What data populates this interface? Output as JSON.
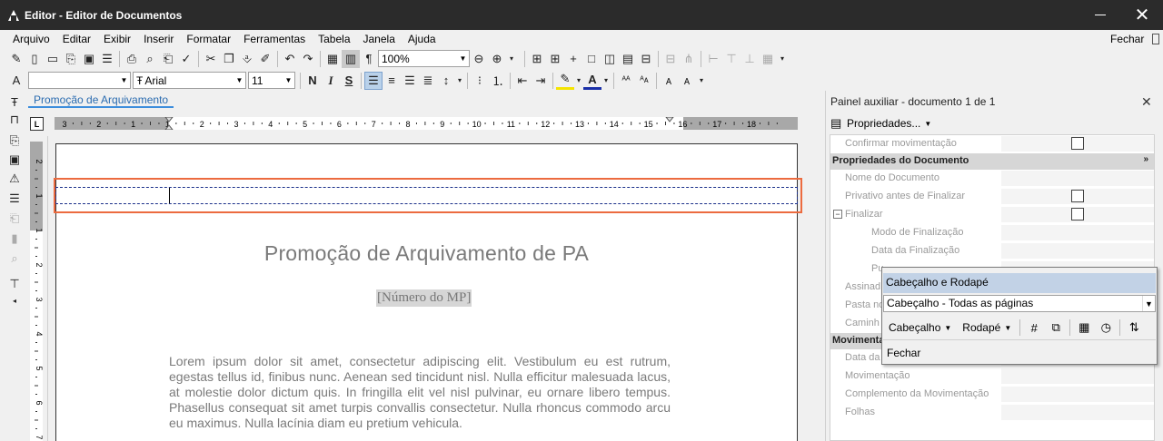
{
  "window": {
    "title": "Editor - Editor de Documentos",
    "close_glyph": "✕"
  },
  "menu": {
    "items": [
      "Arquivo",
      "Editar",
      "Exibir",
      "Inserir",
      "Formatar",
      "Ferramentas",
      "Tabela",
      "Janela",
      "Ajuda"
    ],
    "close_label": "Fechar"
  },
  "toolbar": {
    "zoom_value": "100%",
    "style_value": "",
    "font_value": "Arial",
    "font_prefix": "Ŧ",
    "size_value": "11",
    "bold_label": "N",
    "italic_label": "I",
    "strike_label": "S",
    "pilcrow": "¶"
  },
  "tab": {
    "label": "Promoção de Arquivamento"
  },
  "ruler": {
    "corner_label": "L",
    "top_numbers": [
      "3",
      "2",
      "1",
      "1",
      "2",
      "3",
      "4",
      "5",
      "6",
      "7",
      "8",
      "9",
      "10",
      "11",
      "12",
      "13",
      "14",
      "15",
      "16",
      "17",
      "18"
    ],
    "side_numbers": [
      "2",
      "1",
      "1",
      "2",
      "3",
      "4",
      "5",
      "6",
      "7"
    ]
  },
  "document": {
    "title": "Promoção de Arquivamento de PA",
    "subtitle": "[Número do MP]",
    "body": "Lorem ipsum dolor sit amet, consectetur adipiscing elit. Vestibulum eu est rutrum, egestas tellus id, finibus nunc. Aenean sed tincidunt nisl. Nulla efficitur malesuada lacus, at molestie dolor dictum quis. In fringilla elit vel nisl pulvinar, eu ornare libero tempus. Phasellus consequat sit amet turpis convallis consectetur. Nulla rhoncus commodo arcu eu maximus. Nulla lacínia diam eu pretium vehicula."
  },
  "panel": {
    "title": "Painel auxiliar - documento 1 de 1",
    "close_glyph": "✕",
    "combo_label": "Propriedades...",
    "rows_top": [
      {
        "label": "Confirmar movimentação",
        "checkbox": true
      }
    ],
    "section1": "Propriedades do Documento",
    "section1_toggle": "»",
    "rows_doc": [
      {
        "label": "Nome do Documento",
        "checkbox": false
      },
      {
        "label": "Privativo antes de Finalizar",
        "checkbox": true
      },
      {
        "label": "Finalizar",
        "checkbox": true,
        "expander": "−"
      },
      {
        "label": "Modo de Finalização",
        "checkbox": false
      },
      {
        "label": "Data da Finalização",
        "checkbox": false
      },
      {
        "label": "Pu",
        "checkbox": false
      },
      {
        "label": "Assinad",
        "checkbox": false
      },
      {
        "label": "Pasta no",
        "checkbox": false
      },
      {
        "label": "Caminh",
        "checkbox": false
      }
    ],
    "section2": "Movimenta",
    "rows_mov": [
      {
        "label": "Data da",
        "checkbox": false
      },
      {
        "label": "Movimentação",
        "checkbox": false
      },
      {
        "label": "Complemento da Movimentação",
        "checkbox": false
      },
      {
        "label": "Folhas",
        "checkbox": false
      }
    ]
  },
  "float_toolbar": {
    "title": "Cabeçalho e Rodapé",
    "combo_value": "Cabeçalho -  Todas as páginas",
    "header_button": "Cabeçalho",
    "footer_button": "Rodapé",
    "close_label": "Fechar"
  },
  "colors": {
    "header_highlight": "#ec6b3f",
    "tab_accent": "#3c8ddc",
    "titlebar": "#2b2b2b"
  }
}
